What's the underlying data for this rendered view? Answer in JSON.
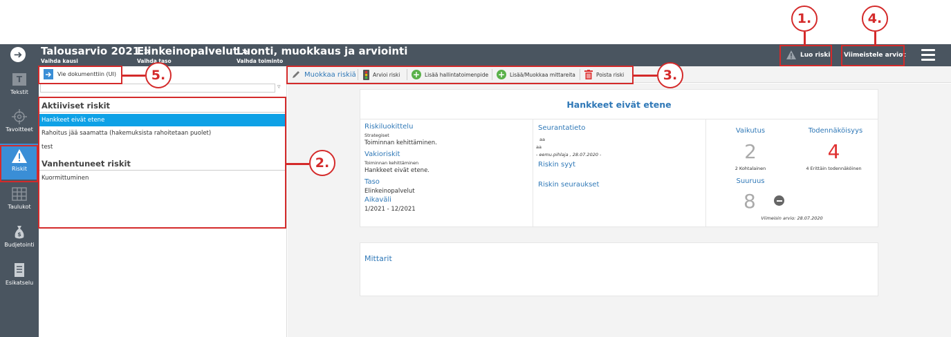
{
  "callouts": [
    "1.",
    "2.",
    "3.",
    "4.",
    "5."
  ],
  "header": {
    "breadcrumb": [
      {
        "title": "Talousarvio 2021 »",
        "sub": "Vaihda kausi"
      },
      {
        "title": "Elinkeinopalvelut »",
        "sub": "Vaihda taso"
      },
      {
        "title": "Luonti, muokkaus ja arviointi",
        "sub": "Vaihda toiminto"
      }
    ],
    "create_risk": "Luo riski",
    "finalize": "Viimeistele arviot"
  },
  "nav": [
    {
      "label": "Tekstit",
      "icon": "text-icon"
    },
    {
      "label": "Tavoitteet",
      "icon": "target-icon"
    },
    {
      "label": "Riskit",
      "icon": "warning-icon"
    },
    {
      "label": "Taulukot",
      "icon": "table-icon"
    },
    {
      "label": "Budjetointi",
      "icon": "moneybag-icon"
    },
    {
      "label": "Esikatselu",
      "icon": "document-icon"
    }
  ],
  "left_panel": {
    "export": "Vie dokumenttiin (UI)",
    "active_title": "Aktiiviset riskit",
    "active": [
      "Hankkeet eivät etene",
      "Rahoitus jää saamatta (hakemuksista rahoitetaan puolet)",
      "test"
    ],
    "expired_title": "Vanhentuneet riskit",
    "expired": [
      "Kuormittuminen"
    ]
  },
  "toolbar": {
    "edit": "Muokkaa riskiä",
    "assess": "Arvioi riski",
    "add_measure": "Lisää hallintatoimenpide",
    "add_metrics": "Lisää/Muokkaa mittareita",
    "delete": "Poista riski"
  },
  "risk": {
    "title": "Hankkeet eivät etene",
    "classification_label": "Riskiluokittelu",
    "classification_sub": "Strategiset",
    "classification_value": "Toiminnan kehittäminen.",
    "standard_label": "Vakioriskit",
    "standard_sub": "Toiminnan kehittäminen",
    "standard_value": "Hankkeet eivät etene.",
    "level_label": "Taso",
    "level_value": "Elinkeinopalvelut",
    "period_label": "Aikaväli",
    "period_value": "1/2021 - 12/2021",
    "monitoring_label": "Seurantatieto",
    "monitoring_line1": "aa",
    "monitoring_line2": "aa",
    "monitoring_meta": "- eemu.pihlaja , 28.07.2020 -",
    "causes_label": "Riskin syyt",
    "consequences_label": "Riskin seuraukset",
    "impact_label": "Vaikutus",
    "impact_value": "2",
    "impact_desc": "2 Kohtalainen",
    "likelihood_label": "Todennäköisyys",
    "likelihood_value": "4",
    "likelihood_desc": "4 Erittäin todennäköinen",
    "magnitude_label": "Suuruus",
    "magnitude_value": "8",
    "last_assessment": "Viimeisin arvio: 28.07.2020",
    "metrics_label": "Mittarit"
  },
  "colors": {
    "header": "#4a5560",
    "accent": "#3a8ed6",
    "callout": "#d42a2a",
    "link": "#2f78b7"
  }
}
